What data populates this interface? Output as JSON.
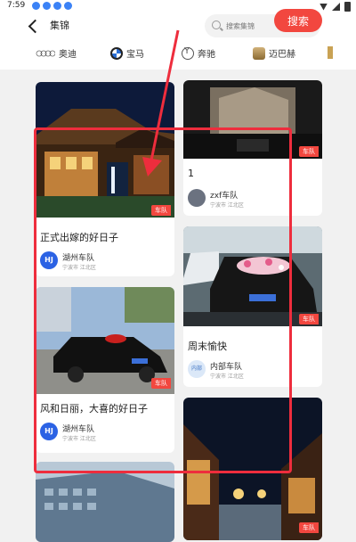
{
  "status": {
    "time": "7:59"
  },
  "header": {
    "title": "集锦",
    "search_placeholder": "搜索集锦",
    "search_button": "搜索"
  },
  "brands": [
    {
      "name": "奥迪",
      "icon": "audi-logo-icon"
    },
    {
      "name": "宝马",
      "icon": "bmw-logo-icon"
    },
    {
      "name": "奔驰",
      "icon": "benz-logo-icon"
    },
    {
      "name": "迈巴赫",
      "icon": "maybach-logo-icon"
    }
  ],
  "badge": "车队",
  "left_cards": [
    {
      "title": "正式出嫁的好日子",
      "avatar_text": "HJ",
      "author": "湖州车队",
      "location": "宁波市 江北区"
    },
    {
      "title": "风和日丽，大喜的好日子",
      "avatar_text": "HJ",
      "author": "湖州车队",
      "location": "宁波市 江北区"
    }
  ],
  "right_cards": [
    {
      "title": "1",
      "author": "zxf车队",
      "location": "宁波市 江北区"
    },
    {
      "title": "周末愉快",
      "avatar_text": "内部",
      "author": "内部车队",
      "location": "宁波市 江北区"
    }
  ],
  "colors": {
    "accent": "#f2473f",
    "avatar": "#2b62e4",
    "annotation": "#ee2d3d"
  }
}
